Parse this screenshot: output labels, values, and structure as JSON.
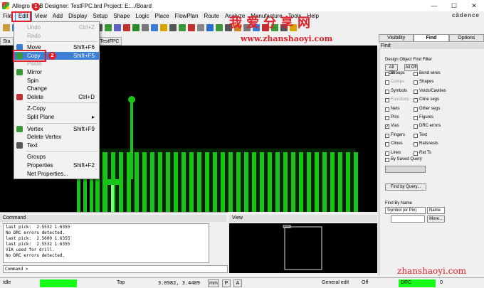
{
  "title": "Allegro PCB Designer: TestFPC.brd  Project: E:.../Board",
  "window_controls": {
    "minimize": "—",
    "maximize": "☐",
    "close": "✕"
  },
  "menu": [
    "File",
    "Edit",
    "View",
    "Add",
    "Display",
    "Setup",
    "Shape",
    "Logic",
    "Place",
    "FlowPlan",
    "Route",
    "Analyze",
    "Manufacture",
    "Tools",
    "Help"
  ],
  "brand": "cādence",
  "tabs_left": [
    "Sta",
    "TestFPC"
  ],
  "edit_menu": [
    {
      "label": "Undo",
      "shortcut": "Ctrl+Z",
      "disabled": true
    },
    {
      "label": "Redo",
      "shortcut": "",
      "disabled": true
    },
    {
      "sep": true
    },
    {
      "label": "Move",
      "shortcut": "Shift+F6"
    },
    {
      "label": "Copy",
      "shortcut": "Shift+F5",
      "highlight": true
    },
    {
      "label": "Paste",
      "shortcut": "",
      "disabled": true
    },
    {
      "label": "Mirror",
      "shortcut": ""
    },
    {
      "label": "Spin",
      "shortcut": ""
    },
    {
      "label": "Change",
      "shortcut": ""
    },
    {
      "label": "Delete",
      "shortcut": "Ctrl+D"
    },
    {
      "sep": true
    },
    {
      "label": "Z-Copy",
      "shortcut": ""
    },
    {
      "label": "Split Plane",
      "shortcut": "▸"
    },
    {
      "sep": true
    },
    {
      "label": "Vertex",
      "shortcut": "Shift+F9"
    },
    {
      "label": "Delete Vertex",
      "shortcut": ""
    },
    {
      "label": "Text",
      "shortcut": ""
    },
    {
      "sep": true
    },
    {
      "label": "Groups",
      "shortcut": ""
    },
    {
      "label": "Properties",
      "shortcut": "Shift+F2"
    },
    {
      "label": "Net Properties...",
      "shortcut": ""
    }
  ],
  "annotations": {
    "badge1": "1",
    "badge2": "2",
    "watermark": "我爱分享网",
    "watermark_url": "www.zhanshaoyi.com",
    "watermark_bottom": "zhanshaoyi.com"
  },
  "right_tabs": [
    "Visibility",
    "Find",
    "Options"
  ],
  "find": {
    "header": "Find",
    "group_title": "Design Object Find Filter",
    "all_on": "All On",
    "all_off": "All Off",
    "left_items": [
      {
        "label": "Groups",
        "checked": false,
        "disabled": false
      },
      {
        "label": "Comps",
        "checked": false,
        "disabled": true
      },
      {
        "label": "Symbols",
        "checked": false,
        "disabled": false
      },
      {
        "label": "Functions",
        "checked": false,
        "disabled": true
      },
      {
        "label": "Nets",
        "checked": false,
        "disabled": false
      },
      {
        "label": "Pins",
        "checked": false,
        "disabled": false
      },
      {
        "label": "Vias",
        "checked": true,
        "disabled": false
      },
      {
        "label": "Fingers",
        "checked": false,
        "disabled": false
      },
      {
        "label": "Clines",
        "checked": false,
        "disabled": false
      },
      {
        "label": "Lines",
        "checked": false,
        "disabled": false
      }
    ],
    "right_items": [
      {
        "label": "Bond wires",
        "checked": false
      },
      {
        "label": "Shapes",
        "checked": false
      },
      {
        "label": "Voids/Cavities",
        "checked": false
      },
      {
        "label": "Cline segs",
        "checked": false
      },
      {
        "label": "Other segs",
        "checked": false
      },
      {
        "label": "Figures",
        "checked": false
      },
      {
        "label": "DRC errors",
        "checked": false
      },
      {
        "label": "Text",
        "checked": false
      },
      {
        "label": "Ratsnests",
        "checked": false
      },
      {
        "label": "Rat Ts",
        "checked": false
      }
    ],
    "by_saved_query": "By Saved Query",
    "find_by_query": "Find by Query...",
    "find_by_name": "Find By Name",
    "name_type": "Symbol (or Pin)",
    "name_mode": "Name",
    "more": "More..."
  },
  "command": {
    "header": "Command",
    "log": [
      "last pick:  2.5532 1.6355",
      "No DRC errors detected.",
      "last pick:  2.5600 1.6355",
      "last pick:  2.5532 1.6355",
      "VIA used for drill.",
      "No DRC errors detected."
    ],
    "prompt": "Command >"
  },
  "view_header": "View",
  "status": {
    "idle": "Idle",
    "layer": "Top",
    "coords": "3.0982, 3.4489",
    "mm": "mm",
    "p": "P",
    "a": "A",
    "mode": "General edit",
    "off": "Off",
    "drc": "DRC",
    "count": "0"
  },
  "colors": {
    "accent": "#3b7fd6",
    "annotation": "#e0202a",
    "trace": "#19c419",
    "status_green": "#16ff16"
  }
}
